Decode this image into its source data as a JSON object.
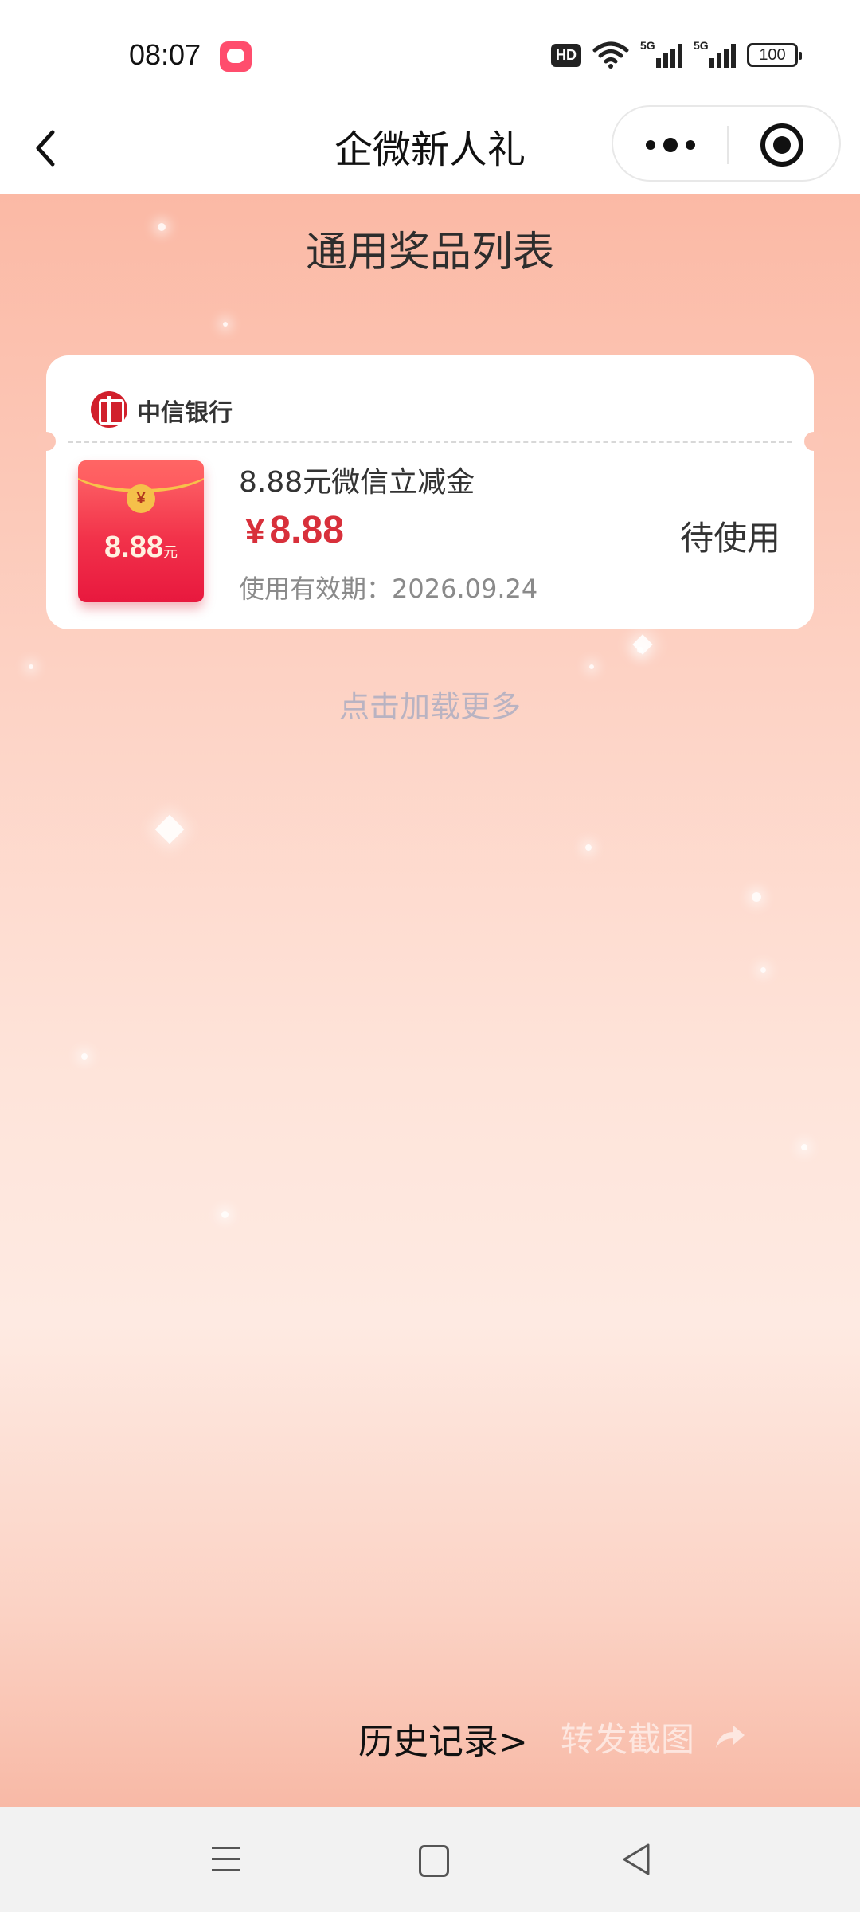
{
  "status_bar": {
    "time": "08:07",
    "hd_label": "HD",
    "signal_1_label": "5G",
    "signal_2_label": "5G",
    "battery": "100"
  },
  "nav": {
    "title": "企微新人礼",
    "back_icon": "chevron-left-icon",
    "more_icon": "more-dots-icon",
    "close_icon": "target-close-icon"
  },
  "main": {
    "heading": "通用奖品列表",
    "coupon": {
      "bank_name": "中信银行",
      "envelope_amount": "8.88",
      "envelope_unit": "元",
      "title": "8.88元微信立减金",
      "price_symbol": "¥",
      "price": "8.88",
      "expiry": "使用有效期：2026.09.24",
      "status": "待使用"
    },
    "load_more": "点击加载更多",
    "history_link": "历史记录>",
    "share_link": "转发截图"
  },
  "colors": {
    "accent_red": "#d8303b",
    "bg_top": "#fbb9a5",
    "bg_mid": "#feeae2"
  }
}
